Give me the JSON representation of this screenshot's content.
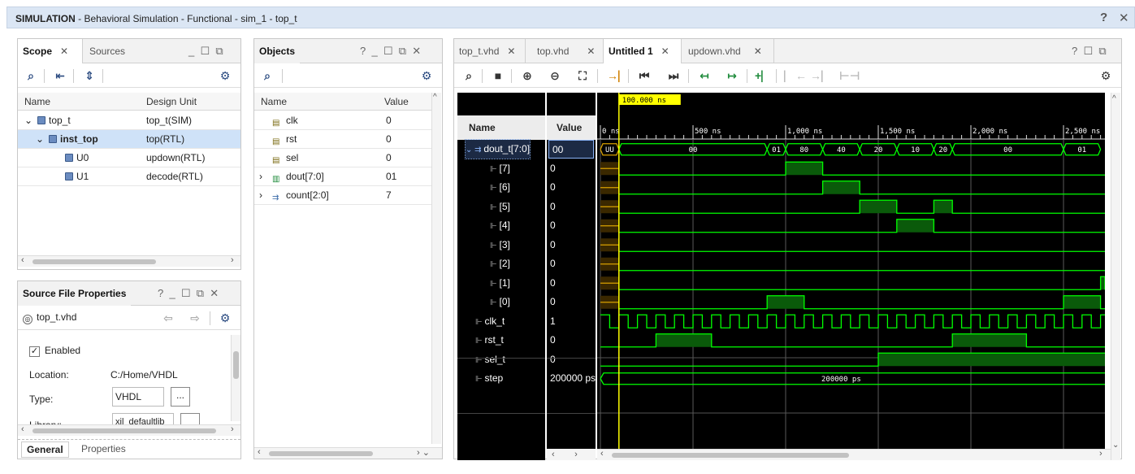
{
  "window": {
    "mode": "SIMULATION",
    "subtitle": " - Behavioral Simulation - Functional - sim_1 - top_t",
    "help": "?",
    "close": "✕"
  },
  "scope_panel": {
    "tabs": [
      {
        "label": "Scope",
        "close": "✕"
      },
      {
        "label": "Sources"
      }
    ],
    "columns": [
      "Name",
      "Design Unit"
    ],
    "rows": [
      {
        "name": "top_t",
        "unit": "top_t(SIM)",
        "expander": "⌄"
      },
      {
        "name": "inst_top",
        "unit": "top(RTL)",
        "expander": "⌄"
      },
      {
        "name": "U0",
        "unit": "updown(RTL)",
        "expander": ""
      },
      {
        "name": "U1",
        "unit": "decode(RTL)",
        "expander": ""
      }
    ]
  },
  "sfp_panel": {
    "title": "Source File Properties",
    "file": "top_t.vhd",
    "enabled_label": "Enabled",
    "location_label": "Location:",
    "location_value": "C:/Home/VHDL",
    "type_label": "Type:",
    "type_value": "VHDL",
    "browse": "...",
    "library_label": "Library:",
    "library_value": "xil_defaultlib",
    "tabs": [
      "General",
      "Properties"
    ]
  },
  "objects_panel": {
    "title": "Objects",
    "columns": [
      "Name",
      "Value"
    ],
    "rows": [
      {
        "name": "clk",
        "value": "0",
        "expander": ""
      },
      {
        "name": "rst",
        "value": "0",
        "expander": ""
      },
      {
        "name": "sel",
        "value": "0",
        "expander": ""
      },
      {
        "name": "dout[7:0]",
        "value": "01",
        "expander": "›"
      },
      {
        "name": "count[2:0]",
        "value": "7",
        "expander": "›"
      }
    ]
  },
  "wave_panel": {
    "tabs": [
      {
        "label": "top_t.vhd",
        "close": "✕"
      },
      {
        "label": "top.vhd",
        "close": "✕"
      },
      {
        "label": "Untitled 1",
        "close": "✕"
      },
      {
        "label": "updown.vhd",
        "close": "✕"
      }
    ],
    "columns": [
      "Name",
      "Value"
    ],
    "cursor_label": "100.000 ns",
    "time_ticks": [
      "0 ns",
      "500 ns",
      "1,000 ns",
      "1,500 ns",
      "2,000 ns",
      "2,500 ns"
    ],
    "signals": [
      {
        "name": "dout_t[7:0]",
        "value": "00"
      },
      {
        "name": "[7]",
        "value": "0"
      },
      {
        "name": "[6]",
        "value": "0"
      },
      {
        "name": "[5]",
        "value": "0"
      },
      {
        "name": "[4]",
        "value": "0"
      },
      {
        "name": "[3]",
        "value": "0"
      },
      {
        "name": "[2]",
        "value": "0"
      },
      {
        "name": "[1]",
        "value": "0"
      },
      {
        "name": "[0]",
        "value": "0"
      },
      {
        "name": "clk_t",
        "value": "1"
      },
      {
        "name": "rst_t",
        "value": "0"
      },
      {
        "name": "sel_t",
        "value": "0"
      },
      {
        "name": "step",
        "value": "200000 ps"
      }
    ],
    "bus_labels": [
      "UU",
      "00",
      "01",
      "80",
      "40",
      "20",
      "10",
      "20",
      "00",
      "01"
    ],
    "step_label": "200000 ps"
  },
  "colors": {
    "title_bg": "#dbe6f4",
    "wave_green": "#00ff00",
    "wave_fill": "#0a5a0a",
    "cursor": "#ffff00",
    "selection": "#cfe2f8"
  }
}
